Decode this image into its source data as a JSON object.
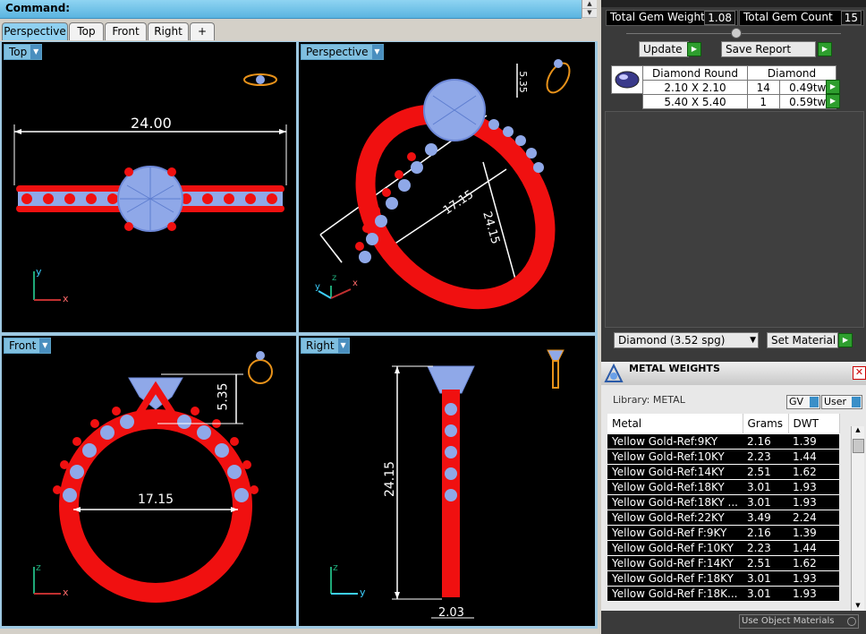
{
  "command": {
    "label": "Command:"
  },
  "tabs": [
    "Perspective",
    "Top",
    "Front",
    "Right"
  ],
  "tab_add": "+",
  "viewports": {
    "top": {
      "label": "Top",
      "dimension": "24.00",
      "axes": [
        "y",
        "x"
      ]
    },
    "perspective": {
      "label": "Perspective",
      "dim_a": "17.15",
      "dim_b": "24.15",
      "dim_c": "5.35",
      "axes": [
        "z",
        "y",
        "x"
      ]
    },
    "front": {
      "label": "Front",
      "dim_a": "17.15",
      "dim_b": "5.35",
      "axes": [
        "z",
        "x"
      ]
    },
    "right": {
      "label": "Right",
      "dim_a": "24.15",
      "dim_b": "2.03",
      "axes": [
        "z",
        "y"
      ]
    }
  },
  "gem_panel": {
    "total_gem_weight_label": "Total Gem Weight",
    "total_gem_weight": "1.08",
    "total_gem_count_label": "Total Gem Count",
    "total_gem_count": "15",
    "update_label": "Update",
    "save_report_label": "Save Report",
    "table_headers": [
      "Diamond Round",
      "Diamond"
    ],
    "rows": [
      {
        "size": "2.10 X 2.10",
        "count": "14",
        "weight": "0.49tw"
      },
      {
        "size": "5.40 X 5.40",
        "count": "1",
        "weight": "0.59tw"
      }
    ],
    "material_select": "Diamond    (3.52 spg)",
    "set_material_label": "Set Material"
  },
  "metal_weights": {
    "title": "METAL WEIGHTS",
    "library": "Library: METAL",
    "gv_label": "GV",
    "user_label": "User",
    "headers": [
      "Metal",
      "Grams",
      "DWT"
    ],
    "rows": [
      [
        "Yellow Gold-Ref:9KY",
        "2.16",
        "1.39"
      ],
      [
        "Yellow Gold-Ref:10KY",
        "2.23",
        "1.44"
      ],
      [
        "Yellow Gold-Ref:14KY",
        "2.51",
        "1.62"
      ],
      [
        "Yellow Gold-Ref:18KY",
        "3.01",
        "1.93"
      ],
      [
        "Yellow Gold-Ref:18KY ...",
        "3.01",
        "1.93"
      ],
      [
        "Yellow Gold-Ref:22KY",
        "3.49",
        "2.24"
      ],
      [
        "Yellow Gold-Ref F:9KY",
        "2.16",
        "1.39"
      ],
      [
        "Yellow Gold-Ref F:10KY",
        "2.23",
        "1.44"
      ],
      [
        "Yellow Gold-Ref F:14KY",
        "2.51",
        "1.62"
      ],
      [
        "Yellow Gold-Ref F:18KY",
        "3.01",
        "1.93"
      ],
      [
        "Yellow Gold-Ref F:18K...",
        "3.01",
        "1.93"
      ]
    ],
    "use_object_materials": "Use Object Materials"
  }
}
